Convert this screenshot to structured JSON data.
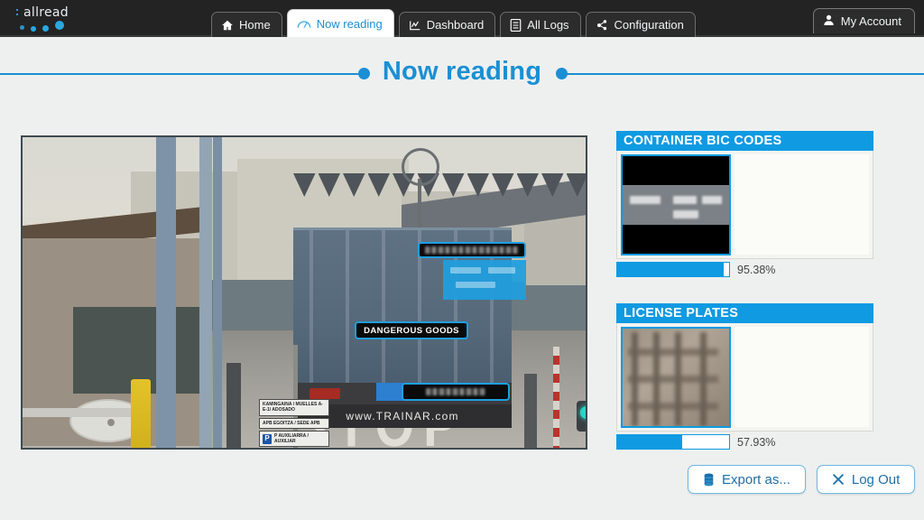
{
  "brand": {
    "name": "allread"
  },
  "nav": {
    "tabs": [
      {
        "label": "Home",
        "icon": "home-icon",
        "active": false
      },
      {
        "label": "Now reading",
        "icon": "gauge-icon",
        "active": true
      },
      {
        "label": "Dashboard",
        "icon": "chart-icon",
        "active": false
      },
      {
        "label": "All Logs",
        "icon": "list-icon",
        "active": false
      },
      {
        "label": "Configuration",
        "icon": "nodes-icon",
        "active": false
      }
    ],
    "account": {
      "label": "My Account",
      "icon": "person-icon"
    }
  },
  "page": {
    "title": "Now reading",
    "accent": "#1b8fd4"
  },
  "video": {
    "overlays": {
      "bic_code": {
        "label": "",
        "redacted": true
      },
      "dangerous_goods": {
        "label": "DANGEROUS GOODS"
      },
      "license_plate": {
        "label": "",
        "redacted": true
      }
    },
    "scene_text": {
      "trailer_brand": "www.TRAINAR.com",
      "road_marking": "STOP",
      "signs": [
        "KAMINGAINA / MUELLES A- E-1/ ADOSADO",
        "APB EGOITZA / SEDE APB",
        "P  AUXILIARRA / AUXILIAR"
      ]
    }
  },
  "cards": [
    {
      "title": "CONTAINER BIC CODES",
      "value_redacted": true,
      "confidence": "95.38%",
      "confidence_pct": 95.38,
      "accent": "#0f9ae2"
    },
    {
      "title": "LICENSE PLATES",
      "value_redacted": true,
      "confidence": "57.93%",
      "confidence_pct": 57.93,
      "accent": "#0f9ae2"
    }
  ],
  "footer": {
    "export": {
      "label": "Export as...",
      "icon": "database-icon"
    },
    "logout": {
      "label": "Log Out",
      "icon": "close-x-icon"
    }
  }
}
